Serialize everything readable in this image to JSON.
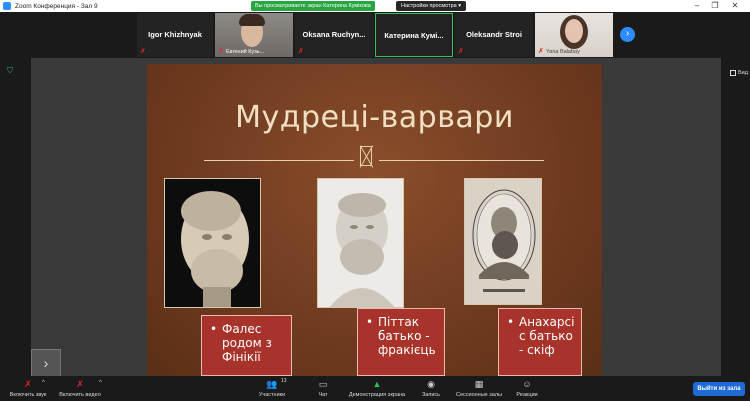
{
  "window": {
    "title": "Zoom Конференция - Зал 9",
    "minimize": "–",
    "maximize": "❐",
    "close": "✕"
  },
  "banner": {
    "text": "Вы просматриваете экран Катерина Кумікова",
    "view_options": "Настройки просмотра ▾"
  },
  "participants": [
    {
      "name": "Igor Khizhnyak"
    },
    {
      "name": "",
      "label": "Евгений Кузь..."
    },
    {
      "name": "Oksana  Ruchyn..."
    },
    {
      "name": "Катерина  Кумі..."
    },
    {
      "name": "Oleksandr Stroi"
    },
    {
      "name": "",
      "label": "Yana Balabay"
    }
  ],
  "strip_next_icon": "›",
  "view_label": "Вид",
  "slide": {
    "title": "Мудреці-варвари",
    "captions": [
      "Фалес родом з Фінікії",
      "Піттак батько - фракієць",
      "Анахарсі с батько - скіф"
    ]
  },
  "side_chevron": "›",
  "toolbar": {
    "mute": "Включить звук",
    "video": "Включить видео",
    "participants": "Участники",
    "participants_count": "13",
    "chat": "Чат",
    "share": "Демонстрация экрана",
    "record": "Запись",
    "breakout": "Сессионные залы",
    "reactions": "Реакции",
    "exit": "Выйти из зала"
  },
  "colors": {
    "accent": "#2d8cff",
    "share_green": "#26a541",
    "caption_red": "#a8332a",
    "slide_brown": "#6e3a1f"
  }
}
